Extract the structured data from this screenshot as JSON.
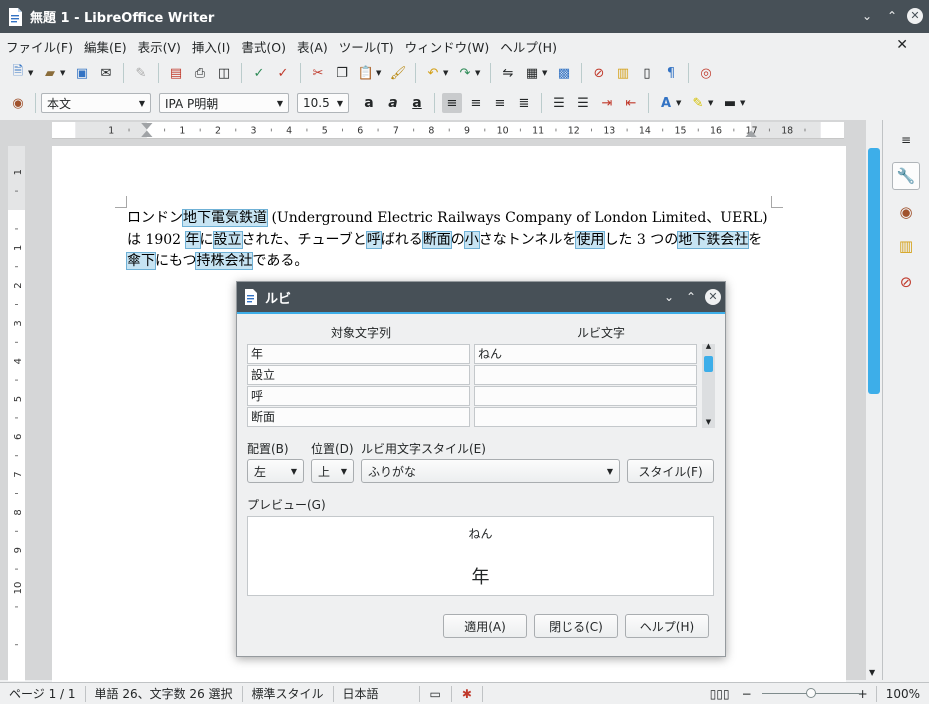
{
  "window": {
    "title": "無題 1 - LibreOffice Writer"
  },
  "menu": [
    "ファイル(F)",
    "編集(E)",
    "表示(V)",
    "挿入(I)",
    "書式(O)",
    "表(A)",
    "ツール(T)",
    "ウィンドウ(W)",
    "ヘルプ(H)"
  ],
  "format": {
    "para_style": "本文",
    "font": "IPA P明朝",
    "size": "10.5"
  },
  "ruler": {
    "h_numbers": [
      "1",
      "1",
      "2",
      "3",
      "4",
      "5",
      "6",
      "7",
      "8",
      "9",
      "10",
      "11",
      "12",
      "13",
      "14",
      "15",
      "16",
      "17",
      "18"
    ],
    "v_numbers": [
      "1",
      "1",
      "2",
      "3",
      "4",
      "5",
      "6",
      "7",
      "8",
      "9",
      "10"
    ]
  },
  "document": {
    "seg": [
      "ロンドン",
      "地下電気鉄道",
      " (Underground Electric Railways Company of London Limited、UERL)は 1902 ",
      "年",
      "に",
      "設立",
      "された、チューブと",
      "呼",
      "ばれる",
      "断面",
      "の",
      "小",
      "さなトンネルを",
      "使用",
      "した 3 つの",
      "地下鉄会社",
      "を",
      "傘下",
      "にもつ",
      "持株会社",
      "である。"
    ]
  },
  "dialog": {
    "title": "ルビ",
    "col_base": "対象文字列",
    "col_ruby": "ルビ文字",
    "rows": [
      {
        "base": "年",
        "ruby": "ねん"
      },
      {
        "base": "設立",
        "ruby": ""
      },
      {
        "base": "呼",
        "ruby": ""
      },
      {
        "base": "断面",
        "ruby": ""
      }
    ],
    "label_align": "配置(B)",
    "label_position": "位置(D)",
    "label_charstyle": "ルビ用文字スタイル(E)",
    "align_value": "左",
    "position_value": "上",
    "charstyle_value": "ふりがな",
    "style_button": "スタイル(F)",
    "label_preview": "プレビュー(G)",
    "preview_ruby": "ねん",
    "preview_base": "年",
    "apply": "適用(A)",
    "close": "閉じる(C)",
    "help": "ヘルプ(H)"
  },
  "status": {
    "page": "ページ 1 / 1",
    "words": "単語 26、文字数 26 選択",
    "page_style": "標準スタイル",
    "lang": "日本語",
    "zoom": "100%"
  },
  "colors": {
    "accent": "#3daee9",
    "titlebar": "#475057"
  }
}
